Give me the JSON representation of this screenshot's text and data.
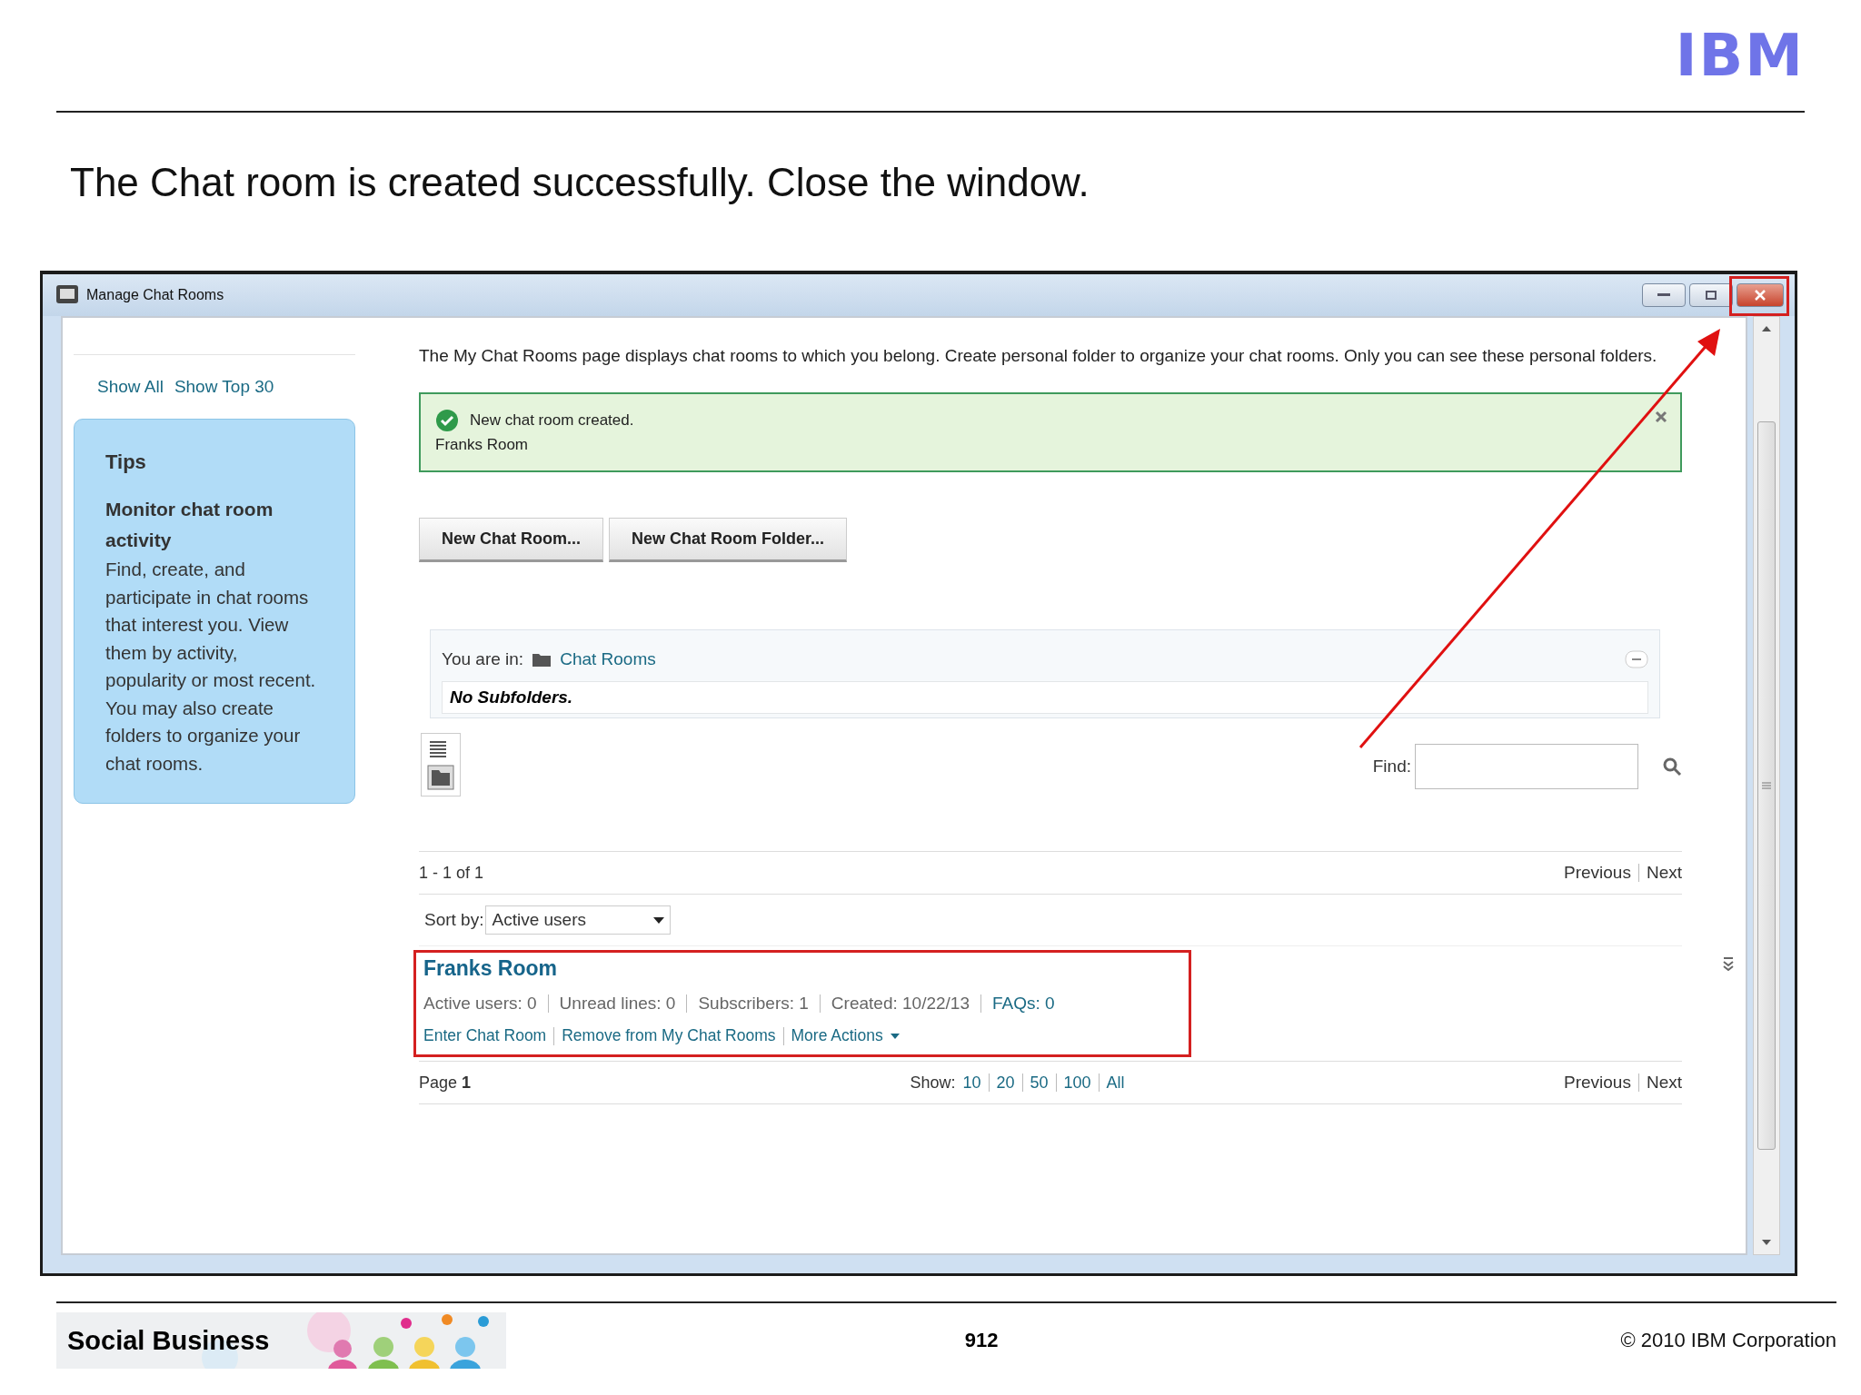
{
  "slide": {
    "logo": "IBM",
    "heading": "The Chat room is created successfully. Close the window.",
    "banner": {
      "title": "Social Business"
    },
    "page_number": "912",
    "copyright": "© 2010 IBM Corporation"
  },
  "window": {
    "title": "Manage Chat Rooms"
  },
  "sidebar": {
    "links": [
      "Show All",
      "Show Top 30"
    ],
    "tips": {
      "title": "Tips",
      "subtitle": "Monitor chat room activity",
      "body": "Find, create, and participate in chat rooms that interest you. View them by activity, popularity or most recent. You may also create folders to organize your chat rooms."
    }
  },
  "main": {
    "description": "The My Chat Rooms page displays chat rooms to which you belong. Create personal folder to organize your chat rooms. Only you can see these personal folders.",
    "notice": {
      "message": "New chat room created.",
      "detail": "Franks Room"
    },
    "buttons": [
      "New Chat Room...",
      "New Chat Room Folder..."
    ],
    "breadcrumb": {
      "label": "You are in:",
      "link": "Chat Rooms",
      "empty": "No Subfolders."
    },
    "find": {
      "label": "Find:"
    },
    "pager_top": {
      "range": "1 - 1 of 1",
      "previous": "Previous",
      "next": "Next"
    },
    "sort": {
      "label": "Sort by:",
      "value": "Active users"
    },
    "rooms": [
      {
        "name": "Franks Room",
        "highlighted": true,
        "stats": [
          "Active users: 0",
          "Unread lines: 0",
          "Subscribers: 1",
          "Created: 10/22/13"
        ],
        "faqs": "FAQs: 0",
        "actions": [
          "Enter Chat Room",
          "Remove from My Chat Rooms",
          "More Actions"
        ]
      }
    ],
    "pager_bottom": {
      "page_label": "Page",
      "page": "1",
      "show_label": "Show:",
      "sizes": [
        "10",
        "20",
        "50",
        "100",
        "All"
      ],
      "previous": "Previous",
      "next": "Next"
    }
  }
}
